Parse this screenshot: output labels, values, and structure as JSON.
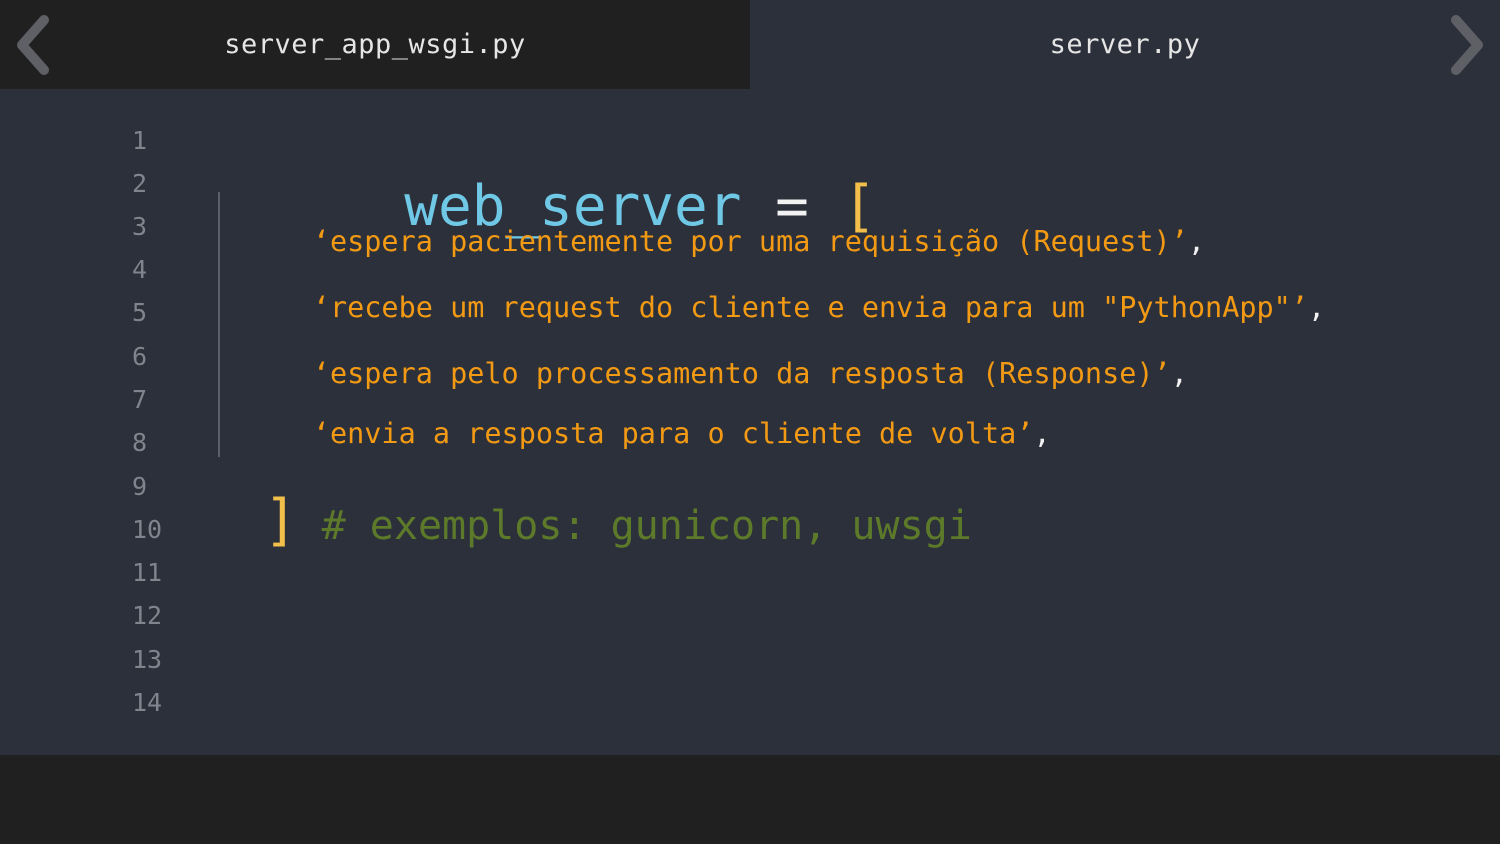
{
  "tabs": [
    {
      "label": "server_app_wsgi.py",
      "active": true
    },
    {
      "label": "server.py",
      "active": false
    }
  ],
  "nav": {
    "prev_icon": "chevron-left-icon",
    "next_icon": "chevron-right-icon"
  },
  "editor": {
    "line_numbers": [
      "1",
      "2",
      "3",
      "4",
      "5",
      "6",
      "7",
      "8",
      "9",
      "10",
      "11",
      "12",
      "13",
      "14"
    ],
    "line1": {
      "variable": "web_server",
      "operator": "=",
      "open_bracket": "["
    },
    "items": [
      {
        "text": "‘espera pacientemente por uma requisição (Request)’",
        "comma": ","
      },
      {
        "text": "‘recebe um request do cliente e envia para um \"PythonApp\"’",
        "comma": ","
      },
      {
        "text": "‘espera pelo processamento da resposta (Response)’",
        "comma": ","
      },
      {
        "text": "‘envia a resposta para o cliente de volta’",
        "comma": ","
      }
    ],
    "close_line": {
      "close_bracket": "]",
      "comment": "# exemplos: gunicorn, uwsgi"
    }
  },
  "colors": {
    "background": "#2c303a",
    "tab_active_bg": "#202020",
    "variable": "#6fc8e6",
    "bracket": "#f2c04a",
    "string": "#f39a14",
    "comment": "#5d7a2a",
    "line_number": "#7f848d"
  }
}
